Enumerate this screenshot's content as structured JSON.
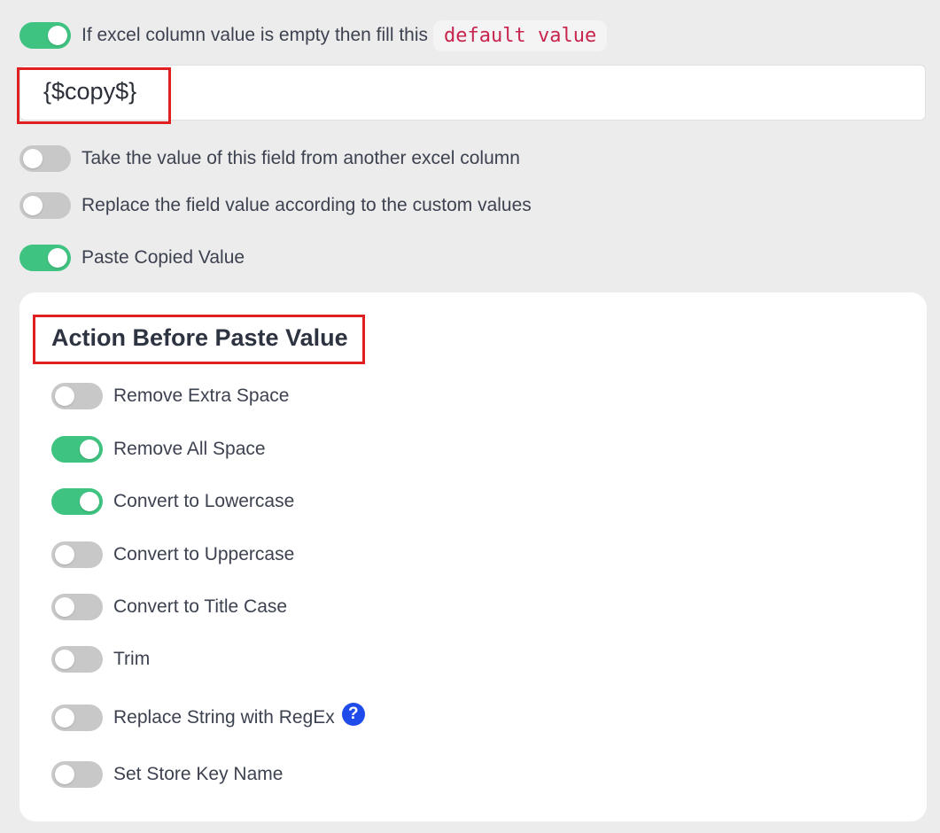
{
  "top_options": {
    "default_fill": {
      "label": "If excel column value is empty then fill this",
      "badge": "default value",
      "enabled": true
    },
    "default_input": {
      "value": "{$copy$}"
    },
    "from_other_column": {
      "label": "Take the value of this field from another excel column",
      "enabled": false
    },
    "custom_values": {
      "label": "Replace the field value according to the custom values",
      "enabled": false
    },
    "paste_copied": {
      "label": "Paste Copied Value",
      "enabled": true
    }
  },
  "action_panel": {
    "title": "Action Before Paste Value",
    "items": [
      {
        "label": "Remove Extra Space",
        "enabled": false
      },
      {
        "label": "Remove All Space",
        "enabled": true
      },
      {
        "label": "Convert to Lowercase",
        "enabled": true
      },
      {
        "label": "Convert to Uppercase",
        "enabled": false
      },
      {
        "label": "Convert to Title Case",
        "enabled": false
      },
      {
        "label": "Trim",
        "enabled": false
      },
      {
        "label": "Replace String with RegEx",
        "enabled": false,
        "help_icon": "question-circle-icon"
      },
      {
        "label": "Set Store Key Name",
        "enabled": false
      }
    ]
  },
  "colors": {
    "toggle_on": "#3fc380",
    "toggle_off": "#c8c8c8",
    "highlight_box": "#e02020",
    "code_text": "#c7254e",
    "help_icon": "#1f4bea"
  }
}
